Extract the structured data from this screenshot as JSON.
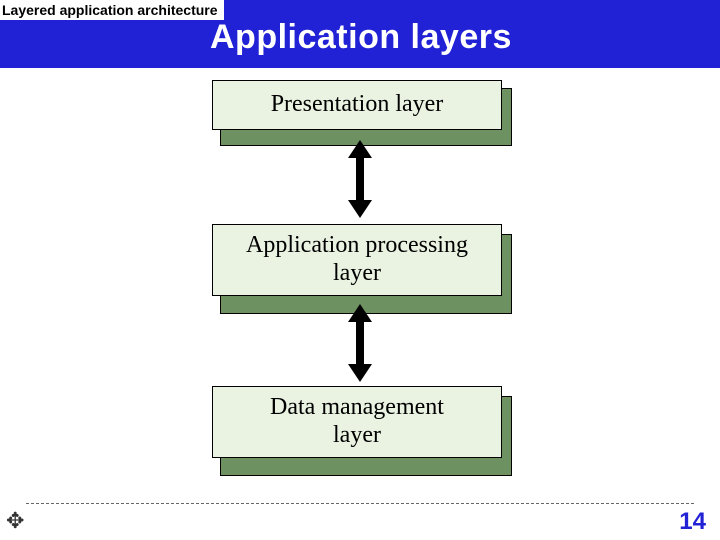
{
  "header": {
    "breadcrumb": "Layered application architecture",
    "title": "Application layers"
  },
  "layers": [
    {
      "label": "Presentation layer"
    },
    {
      "label_line1": "Application processing",
      "label_line2": "layer"
    },
    {
      "label_line1": "Data management",
      "label_line2": "layer"
    }
  ],
  "footer": {
    "page_number": "14",
    "cursor_glyph": "✥"
  },
  "colors": {
    "band": "#2121d6",
    "box_fill": "#eaf2e1",
    "box_shadow": "#6e9161"
  }
}
